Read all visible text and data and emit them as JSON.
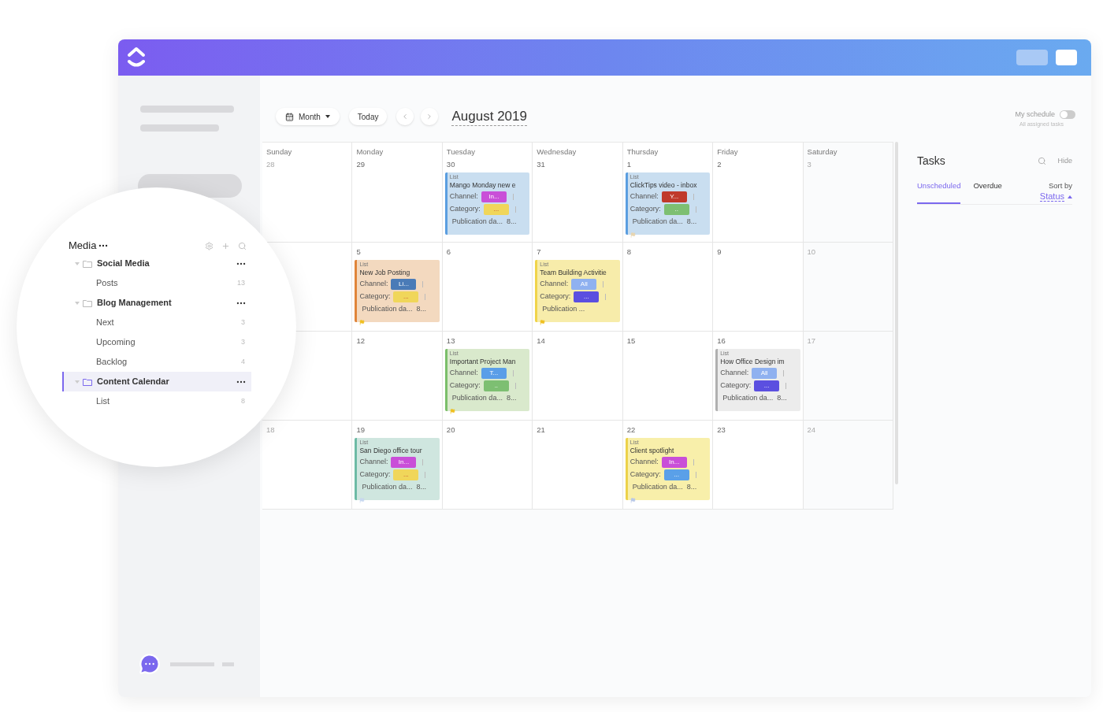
{
  "toolbar": {
    "view_button": "Month",
    "today_button": "Today",
    "title": "August 2019",
    "schedule": {
      "label": "My schedule",
      "sub": "All assigned tasks",
      "on": false
    }
  },
  "calendar": {
    "day_names": [
      "Sunday",
      "Monday",
      "Tuesday",
      "Wednesday",
      "Thursday",
      "Friday",
      "Saturday"
    ],
    "weeks": [
      {
        "sunday": {
          "date": "28"
        },
        "days": [
          {
            "date": "29"
          },
          {
            "date": "30",
            "event": {
              "label": "List",
              "title": "Mango Monday new e",
              "color": "#c9def0",
              "stripe": {
                "color": "#5b9ee0"
              },
              "channel_label": "Channel:",
              "channel": {
                "text": "In...",
                "color": "#c94fd8"
              },
              "category_label": "Category:",
              "category": {
                "text": "...",
                "color": "#f0d65a"
              },
              "publication": "Publication da...",
              "publication_value": "8..."
            }
          },
          {
            "date": "31"
          },
          {
            "date": "1",
            "event": {
              "label": "List",
              "title": "ClickTips video - inbox",
              "color": "#c9def0",
              "stripe": {
                "color": "#5b9ee0"
              },
              "channel_label": "Channel:",
              "channel": {
                "text": "Y...",
                "color": "#c0392b"
              },
              "category_label": "Category:",
              "category": {
                "text": "..",
                "color": "#7dbf72"
              },
              "publication": "Publication da...",
              "publication_value": "8...",
              "flag": {
                "color": "#e8d6b0"
              }
            }
          },
          {
            "date": "2"
          },
          {
            "date": "3"
          }
        ]
      },
      {
        "days": [
          {
            "date": "5",
            "event": {
              "label": "List",
              "title": "New Job Posting",
              "color": "#f3d9bf",
              "stripe": {
                "color": "#e0853a"
              },
              "channel_label": "Channel:",
              "channel": {
                "text": "Li...",
                "color": "#4a7bb7"
              },
              "category_label": "Category:",
              "category": {
                "text": "...",
                "color": "#f0d65a"
              },
              "publication": "Publication da...",
              "publication_value": "8...",
              "flag": {
                "color": "#f0c020"
              }
            }
          },
          {
            "date": "6"
          },
          {
            "date": "7",
            "event": {
              "label": "List",
              "title": "Team Building Activitie",
              "color": "#f7ecaa",
              "stripe": {
                "color": "#f0d44a"
              },
              "channel_label": "Channel:",
              "channel": {
                "text": "All",
                "color": "#8fb1f0"
              },
              "category_label": "Category:",
              "category": {
                "text": "...",
                "color": "#5b4fe0"
              },
              "publication": "Publication ...",
              "flag": {
                "color": "#f0c020"
              }
            }
          },
          {
            "date": "8"
          },
          {
            "date": "9"
          },
          {
            "date": "10"
          }
        ]
      },
      {
        "days": [
          {
            "date": "12"
          },
          {
            "date": "13",
            "event": {
              "label": "List",
              "title": "Important Project Man",
              "color": "#d9e9cc",
              "stripe": {
                "color": "#7bbf6a"
              },
              "channel_label": "Channel:",
              "channel": {
                "text": "T...",
                "color": "#5a9ee8"
              },
              "category_label": "Category:",
              "category": {
                "text": "..",
                "color": "#7dbf72"
              },
              "publication": "Publication da...",
              "publication_value": "8...",
              "flag": {
                "color": "#f0c020"
              }
            }
          },
          {
            "date": "14"
          },
          {
            "date": "15"
          },
          {
            "date": "16",
            "event": {
              "label": "List",
              "title": "How Office Design im",
              "color": "#ececec",
              "stripe": {
                "color": "#b0b0b0"
              },
              "channel_label": "Channel:",
              "channel": {
                "text": "All",
                "color": "#8fb1f0"
              },
              "category_label": "Category:",
              "category": {
                "text": "...",
                "color": "#5b4fe0"
              },
              "publication": "Publication da...",
              "publication_value": "8..."
            }
          },
          {
            "date": "17"
          }
        ]
      },
      {
        "sunday": {
          "date": "18"
        },
        "days": [
          {
            "date": "19",
            "event": {
              "label": "List",
              "title": "San Diego office tour",
              "color": "#cfe6df",
              "stripe": {
                "color": "#6dbba5"
              },
              "channel_label": "Channel:",
              "channel": {
                "text": "In...",
                "color": "#c94fd8"
              },
              "category_label": "Category:",
              "category": {
                "text": "...",
                "color": "#f0d65a"
              },
              "publication": "Publication da...",
              "publication_value": "8...",
              "flag": {
                "color": "#c8d8f0"
              }
            }
          },
          {
            "date": "20"
          },
          {
            "date": "21"
          },
          {
            "date": "22",
            "event": {
              "label": "List",
              "title": "Client spotlight",
              "color": "#f8efaa",
              "stripe": {
                "color": "#ecd24a"
              },
              "channel_label": "Channel:",
              "channel": {
                "text": "In...",
                "color": "#c94fd8"
              },
              "category_label": "Category:",
              "category": {
                "text": "...",
                "color": "#5aa0e8"
              },
              "publication": "Publication da...",
              "publication_value": "8...",
              "flag": {
                "color": "#b8c8e8"
              }
            }
          },
          {
            "date": "23"
          },
          {
            "date": "24"
          }
        ]
      }
    ]
  },
  "tasks_panel": {
    "title": "Tasks",
    "hide": "Hide",
    "tabs": [
      {
        "label": "Unscheduled",
        "selected": true
      },
      {
        "label": "Overdue",
        "selected": false
      }
    ],
    "sort_label": "Sort by",
    "sort_value": "Status"
  },
  "sidebar_tree": {
    "title": "Media",
    "folders": [
      {
        "label": "Social Media",
        "selected": false,
        "expanded": true,
        "children": [
          {
            "label": "Posts",
            "count": "13",
            "selected": false
          }
        ]
      },
      {
        "label": "Blog Management",
        "selected": false,
        "expanded": true,
        "children": [
          {
            "label": "Next",
            "count": "3",
            "selected": false
          },
          {
            "label": "Upcoming",
            "count": "3",
            "selected": false
          },
          {
            "label": "Backlog",
            "count": "4",
            "selected": false
          }
        ]
      },
      {
        "label": "Content Calendar",
        "selected": true,
        "expanded": true,
        "children": [
          {
            "label": "List",
            "count": "8",
            "selected": false
          }
        ]
      }
    ]
  }
}
